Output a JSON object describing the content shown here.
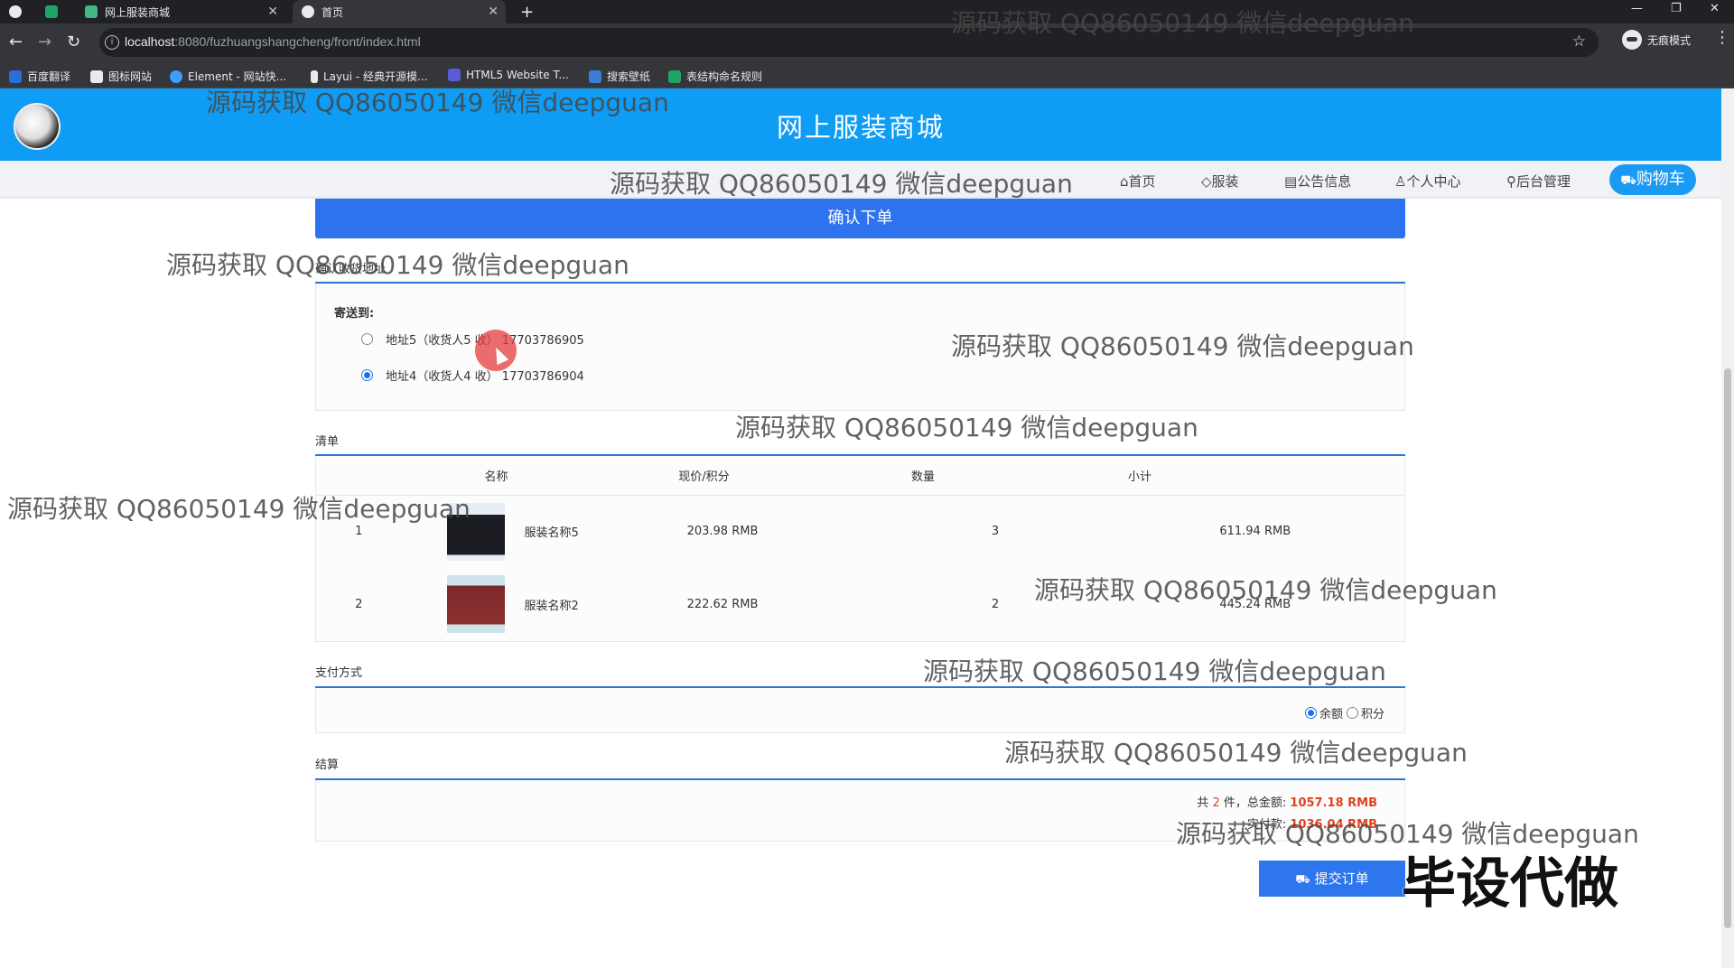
{
  "browser": {
    "tabs": [
      {
        "label": "",
        "active": false
      },
      {
        "label": "网上服装商城",
        "active": false
      },
      {
        "label": "首页",
        "active": true
      }
    ],
    "url_host": "localhost",
    "url_rest": ":8080/fuzhuangshangcheng/front/index.html",
    "profile_label": "无痕模式",
    "bookmarks": [
      "百度翻译",
      "图标网站",
      "Element - 网站快...",
      "Layui - 经典开源模...",
      "HTML5 Website T...",
      "搜索壁纸",
      "表结构命名规则"
    ]
  },
  "site": {
    "title": "网上服装商城",
    "nav": [
      "首页",
      "服装",
      "公告信息",
      "个人中心",
      "后台管理"
    ],
    "cart_label": "购物车"
  },
  "order": {
    "confirm_title": "确认下单",
    "address_section": "确认收货地址",
    "ship_to": "寄送到:",
    "addresses": [
      {
        "text": "地址5（收货人5 收） 17703786905",
        "selected": false
      },
      {
        "text": "地址4（收货人4 收） 17703786904",
        "selected": true
      }
    ],
    "list_section": "清单",
    "columns": [
      "名称",
      "现价/积分",
      "数量",
      "小计"
    ],
    "items": [
      {
        "index": "1",
        "name": "服装名称5",
        "price": "203.98 RMB",
        "qty": "3",
        "subtotal": "611.94 RMB"
      },
      {
        "index": "2",
        "name": "服装名称2",
        "price": "222.62 RMB",
        "qty": "2",
        "subtotal": "445.24 RMB"
      }
    ],
    "payment_section": "支付方式",
    "payment_options": [
      {
        "label": "余额",
        "selected": true
      },
      {
        "label": "积分",
        "selected": false
      }
    ],
    "settle_section": "结算",
    "count_prefix": "共",
    "count": "2",
    "count_suffix": "件，总金额:",
    "total": "1057.18 RMB",
    "paid_label": "实付款:",
    "paid": "1036.04 RMB",
    "submit_label": "提交订单"
  },
  "watermarks": {
    "text": "源码获取 QQ86050149 微信deepguan",
    "stamp": "毕设代做"
  },
  "colors": {
    "header_blue": "#0f9cf5",
    "confirm_blue": "#2d73f0",
    "price_red": "#e3411d"
  }
}
